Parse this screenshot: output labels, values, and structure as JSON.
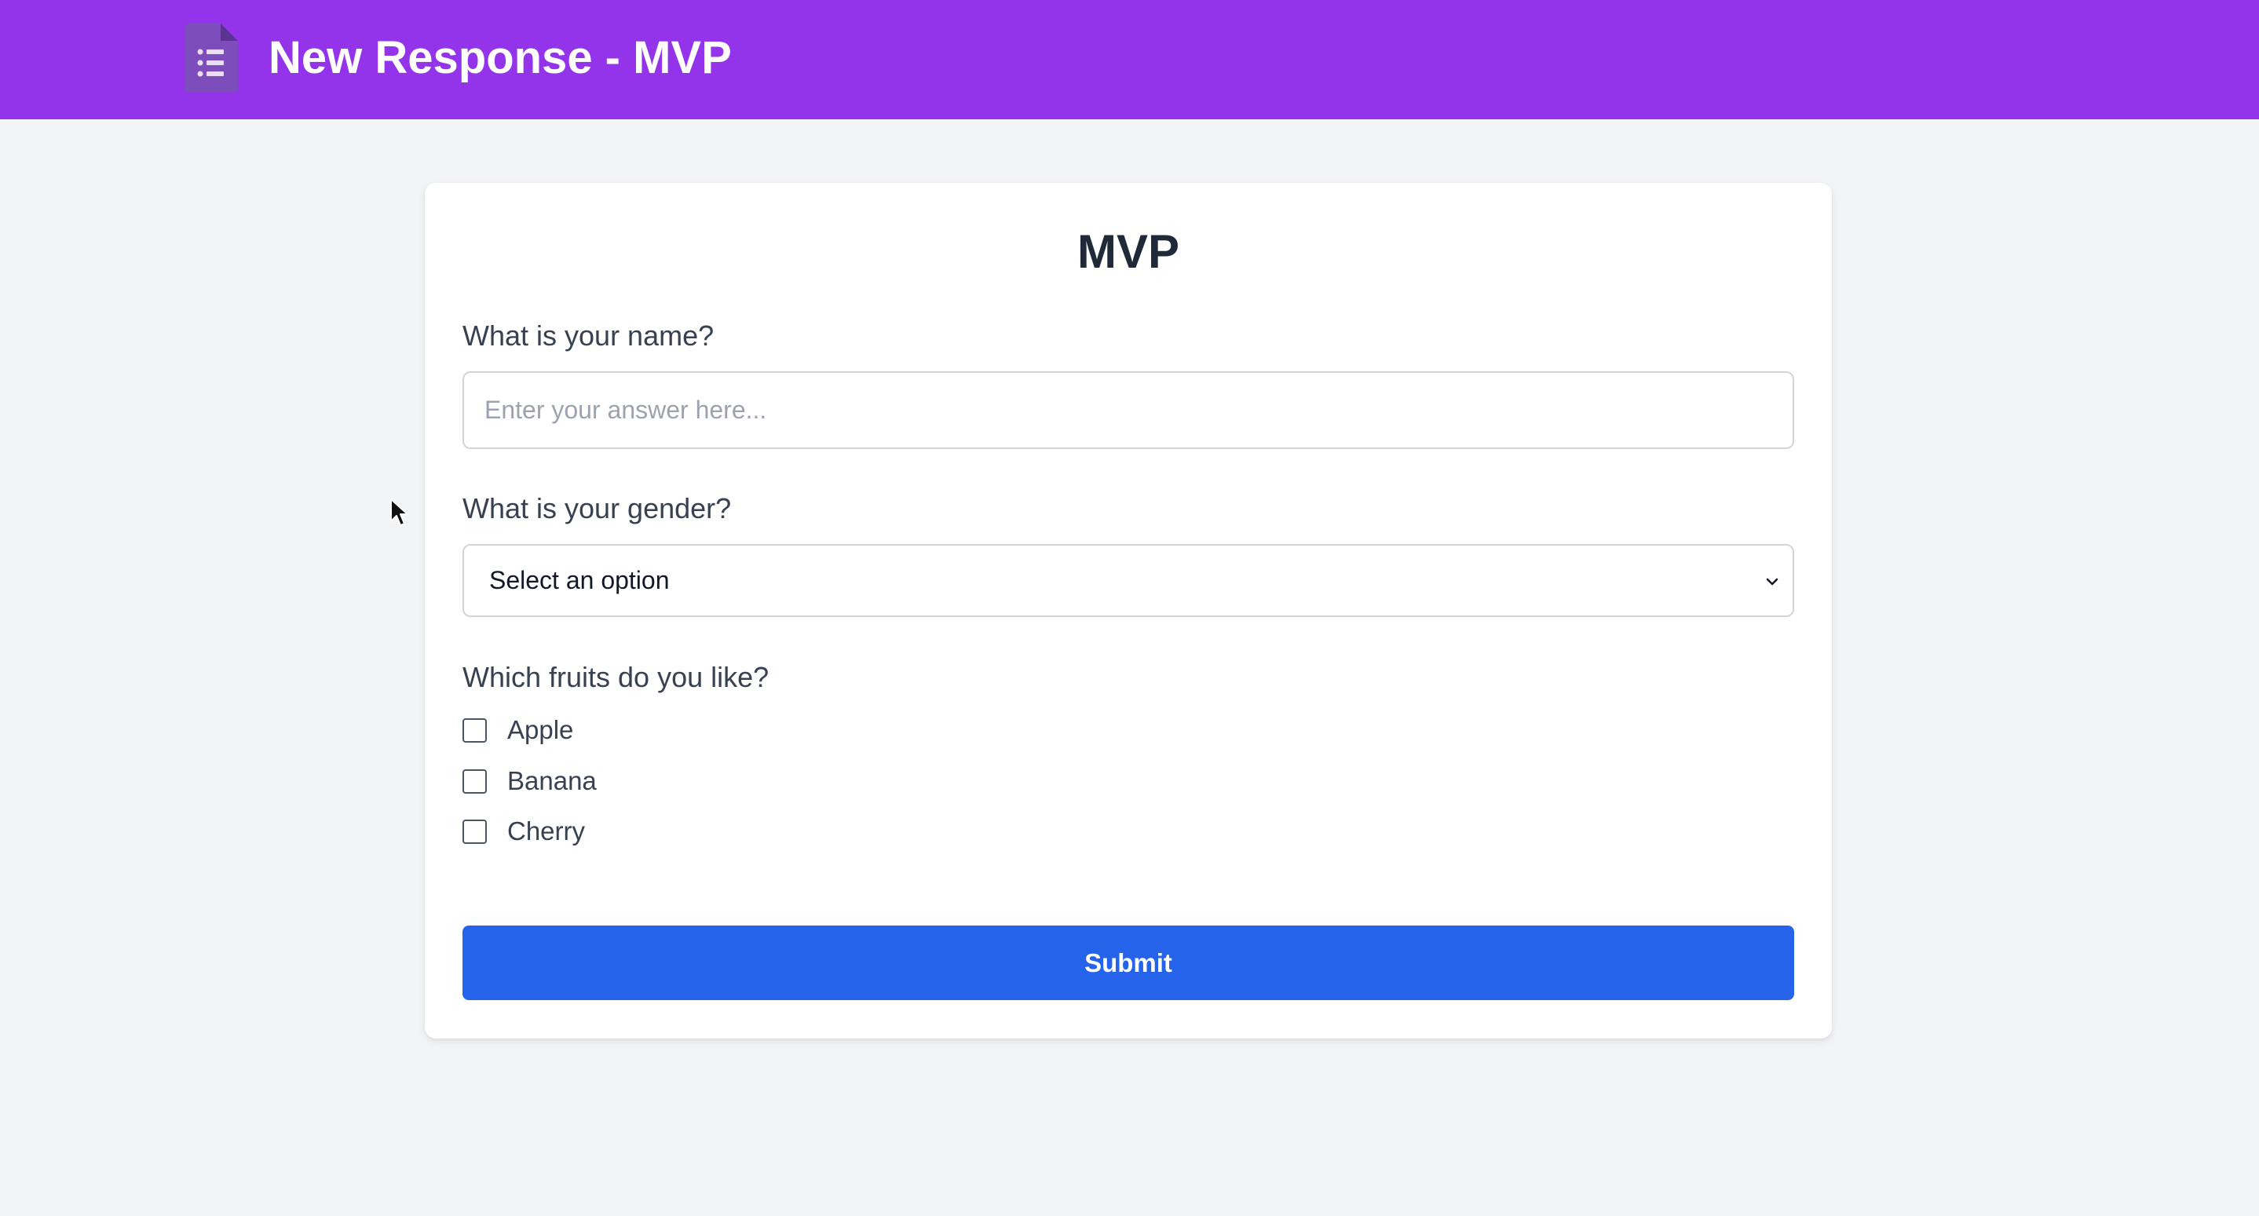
{
  "header": {
    "title": "New Response - MVP",
    "logo_icon": "forms-list-icon",
    "bg_color": "#9333ea"
  },
  "form": {
    "title": "MVP",
    "questions": [
      {
        "label": "What is your name?",
        "type": "text",
        "placeholder": "Enter your answer here...",
        "value": ""
      },
      {
        "label": "What is your gender?",
        "type": "select",
        "selected": "Select an option"
      },
      {
        "label": "Which fruits do you like?",
        "type": "checkbox",
        "options": [
          {
            "label": "Apple",
            "checked": false
          },
          {
            "label": "Banana",
            "checked": false
          },
          {
            "label": "Cherry",
            "checked": false
          }
        ]
      }
    ],
    "submit_label": "Submit",
    "submit_color": "#2563eb"
  }
}
